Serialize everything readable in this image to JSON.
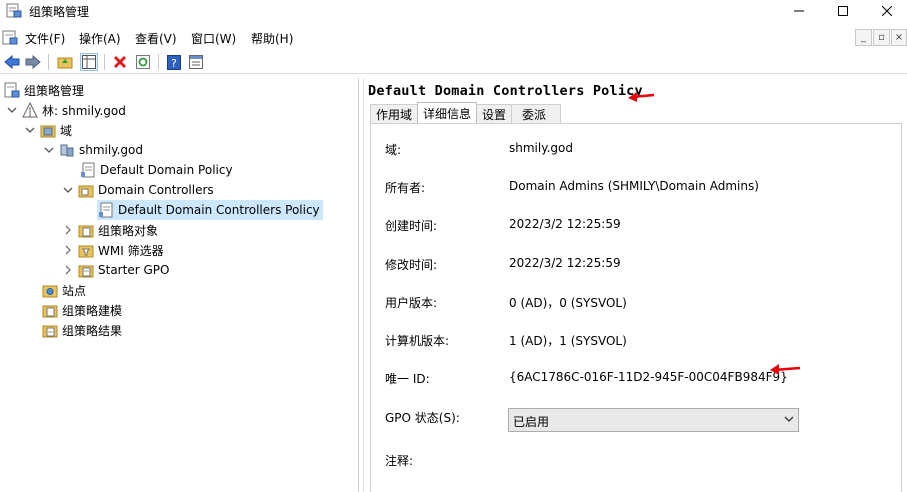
{
  "window": {
    "title": "组策略管理"
  },
  "menu": [
    "文件(F)",
    "操作(A)",
    "查看(V)",
    "窗口(W)",
    "帮助(H)"
  ],
  "toolbar": {
    "icons": [
      "back-icon",
      "forward-icon",
      "up-folder-icon",
      "show-tree-icon",
      "delete-icon",
      "refresh-icon",
      "help-icon",
      "properties-icon"
    ]
  },
  "tree": {
    "root": "组策略管理",
    "forest": "林: shmily.god",
    "domains": "域",
    "domain": "shmily.god",
    "default_domain_policy": "Default Domain Policy",
    "domain_controllers": "Domain Controllers",
    "selected_policy": "Default Domain Controllers Policy",
    "gpo_objects": "组策略对象",
    "wmi_filters": "WMI 筛选器",
    "starter_gpo": "Starter GPO",
    "sites": "站点",
    "modeling": "组策略建模",
    "results": "组策略结果"
  },
  "details": {
    "heading": "Default Domain Controllers Policy",
    "tabs": [
      "作用域",
      "详细信息",
      "设置",
      "委派"
    ],
    "active_tab": "详细信息",
    "fields": [
      {
        "label": "域:",
        "value": "shmily.god"
      },
      {
        "label": "所有者:",
        "value": "Domain Admins (SHMILY\\Domain Admins)"
      },
      {
        "label": "创建时间:",
        "value": "2022/3/2 12:25:59"
      },
      {
        "label": "修改时间:",
        "value": "2022/3/2 12:25:59"
      },
      {
        "label": "用户版本:",
        "value": "0 (AD)，0 (SYSVOL)"
      },
      {
        "label": "计算机版本:",
        "value": "1 (AD)，1 (SYSVOL)"
      },
      {
        "label": "唯一 ID:",
        "value": "{6AC1786C-016F-11D2-945F-00C04FB984F9}"
      }
    ],
    "gpo_status_label": "GPO 状态(S):",
    "gpo_status_value": "已启用",
    "comment_label": "注释:"
  },
  "colors": {
    "selection": "#cce8ff",
    "annotation_arrow": "#e8000b"
  }
}
